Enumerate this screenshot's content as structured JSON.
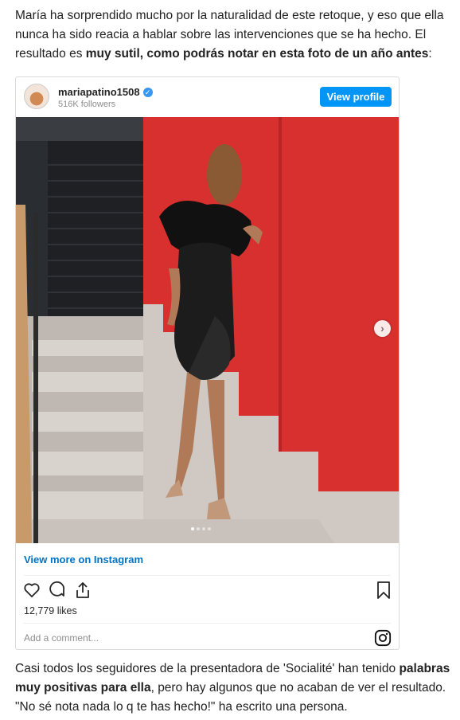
{
  "article": {
    "p1_plain": "María ha sorprendido mucho por la naturalidad de este retoque, y eso que ella nunca ha sido reacia a hablar sobre las intervenciones que se ha hecho. El resultado es ",
    "p1_bold": "muy sutil, como podrás notar en esta foto de un año antes",
    "p1_end": ":",
    "p2_start": "Casi todos los seguidores de la presentadora de 'Socialité' han tenido ",
    "p2_bold": "palabras muy positivas para ella",
    "p2_end": ", pero hay algunos que no acaban de ver el resultado. \"No sé nota nada lo q te has hecho!\" ha escrito una persona."
  },
  "embed": {
    "username": "mariapatino1508",
    "followers": "516K followers",
    "view_profile": "View profile",
    "view_more": "View more on Instagram",
    "likes": "12,779 likes",
    "comment_placeholder": "Add a comment...",
    "carousel_dots": 4,
    "carousel_active": 1
  },
  "icons": [
    "avatar",
    "verified-badge-icon",
    "chevron-right-icon",
    "heart-icon",
    "comment-icon",
    "share-icon",
    "bookmark-icon",
    "instagram-logo-icon"
  ],
  "colors": {
    "accent": "#0095f6",
    "link": "#0073c4",
    "wall_red": "#d8302e"
  }
}
